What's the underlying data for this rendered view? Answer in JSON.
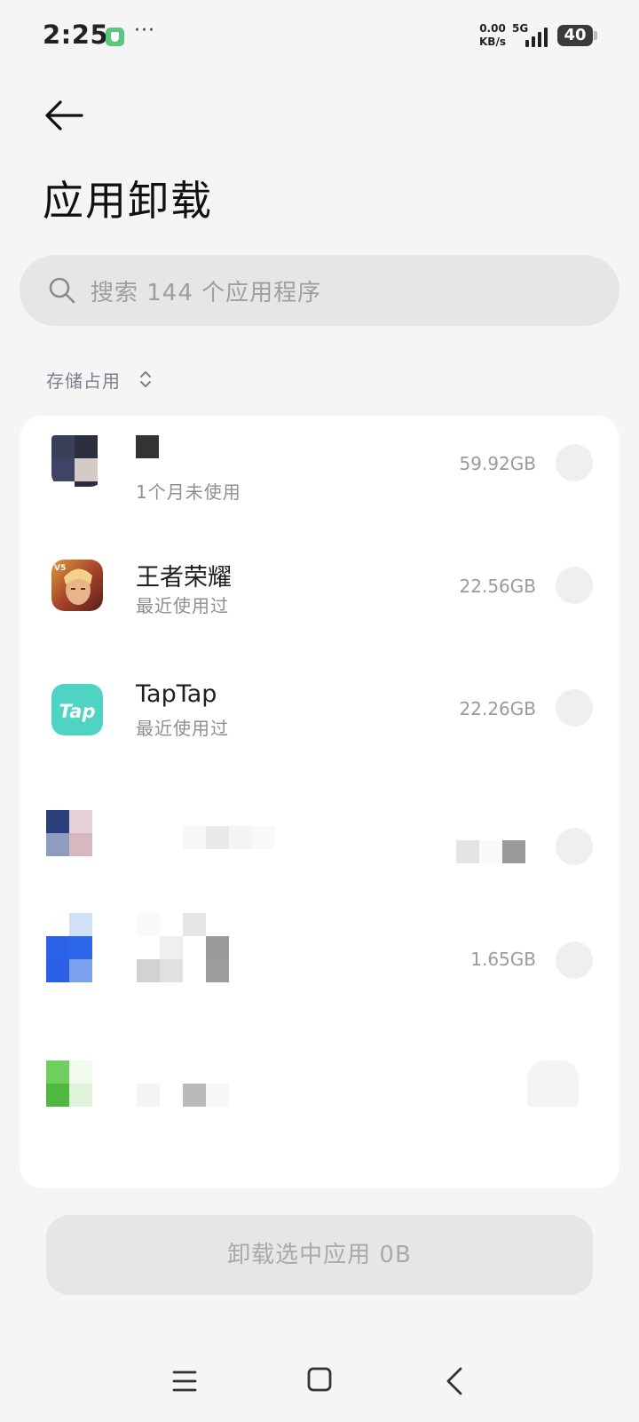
{
  "status_bar": {
    "time": "2:25",
    "more_indicator": "···",
    "net_speed_value": "0.00",
    "net_speed_unit": "KB/s",
    "network_type": "5G",
    "battery_level": "40",
    "vpn_color": "#5cc87f"
  },
  "header": {
    "back_icon": "arrow-left-icon",
    "title": "应用卸载"
  },
  "search": {
    "placeholder": "搜索 144 个应用程序",
    "icon": "search-icon"
  },
  "sort": {
    "label": "存储占用",
    "icon": "sort-updown-icon"
  },
  "apps": [
    {
      "name": "",
      "subtitle": "1个月未使用",
      "size": "59.92GB"
    },
    {
      "name": "王者荣耀",
      "subtitle": "最近使用过",
      "size": "22.56GB"
    },
    {
      "name": "TapTap",
      "subtitle": "最近使用过",
      "size": "22.26GB"
    },
    {
      "name": "",
      "subtitle": "",
      "size": ""
    },
    {
      "name": "",
      "subtitle": "",
      "size": "1.65GB"
    },
    {
      "name": "",
      "subtitle": "",
      "size": ""
    }
  ],
  "action": {
    "uninstall_label": "卸载选中应用 0B"
  },
  "nav_bar": {
    "menu_icon": "menu-icon",
    "home_icon": "home-icon",
    "back_icon": "back-chevron-icon"
  },
  "colors": {
    "background": "#f5f5f5",
    "card": "#ffffff",
    "muted_text": "#9b9b9b",
    "taptap_icon": "#4fd4c4"
  }
}
